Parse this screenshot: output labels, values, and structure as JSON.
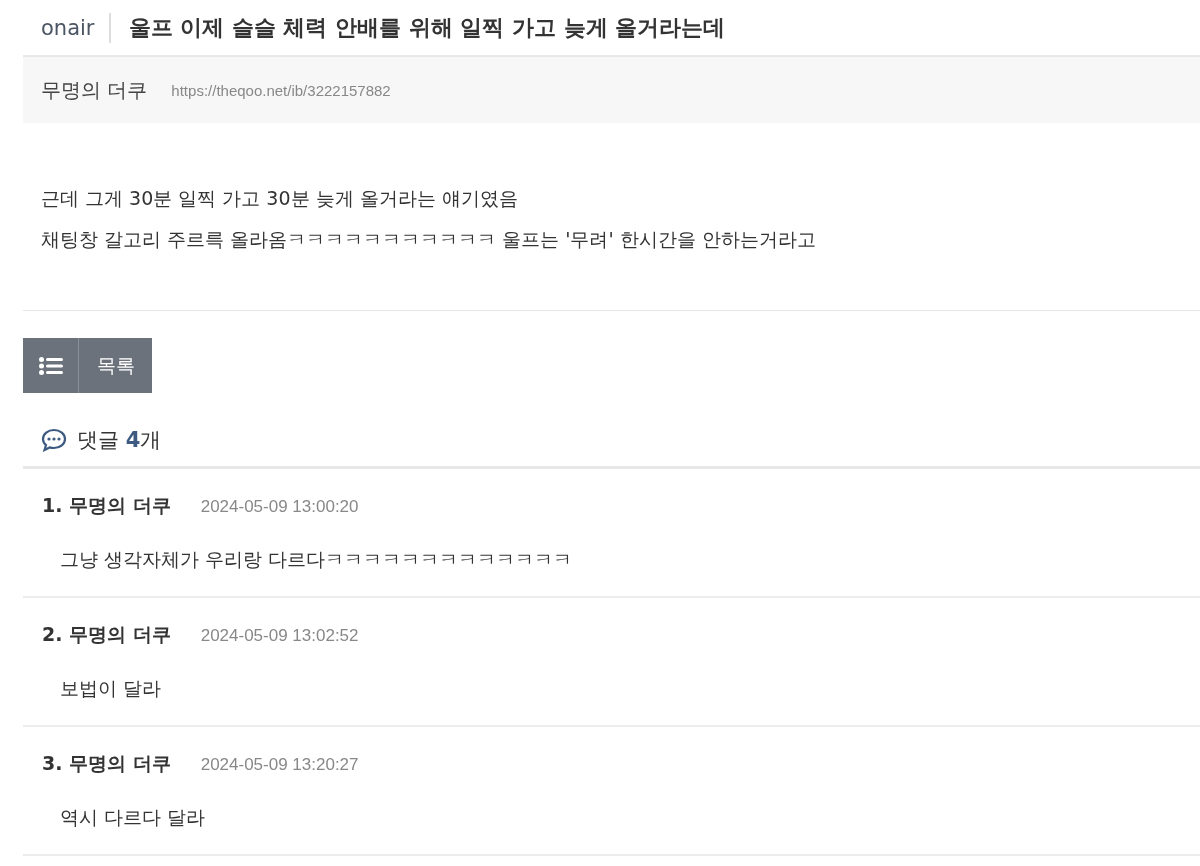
{
  "header": {
    "category": "onair",
    "title": "울프 이제 슬슬 체력 안배를 위해 일찍 가고 늦게 올거라는데"
  },
  "meta": {
    "author": "무명의 더쿠",
    "url": "https://theqoo.net/ib/3222157882"
  },
  "body": [
    "근데 그게 30분 일찍 가고 30분 늦게 올거라는 얘기였음",
    "채팅창 갈고리 주르륵 올라옴ㅋㅋㅋㅋㅋㅋㅋㅋㅋㅋㅋ 울프는 '무려' 한시간을 안하는거라고"
  ],
  "list_button": {
    "label": "목록"
  },
  "comments_header": {
    "text": "댓글 **4**개"
  },
  "comments": [
    {
      "author": "1. 무명의 더쿠",
      "time": "2024-05-09 13:00:20",
      "text": "그냥 생각자체가 우리랑 다르다ㅋㅋㅋㅋㅋㅋㅋㅋㅋㅋㅋㅋㅋ"
    },
    {
      "author": "2. 무명의 더쿠",
      "time": "2024-05-09 13:02:52",
      "text": "보법이 달라"
    },
    {
      "author": "3. 무명의 더쿠",
      "time": "2024-05-09 13:20:27",
      "text": "역시 다르다 달라"
    }
  ]
}
